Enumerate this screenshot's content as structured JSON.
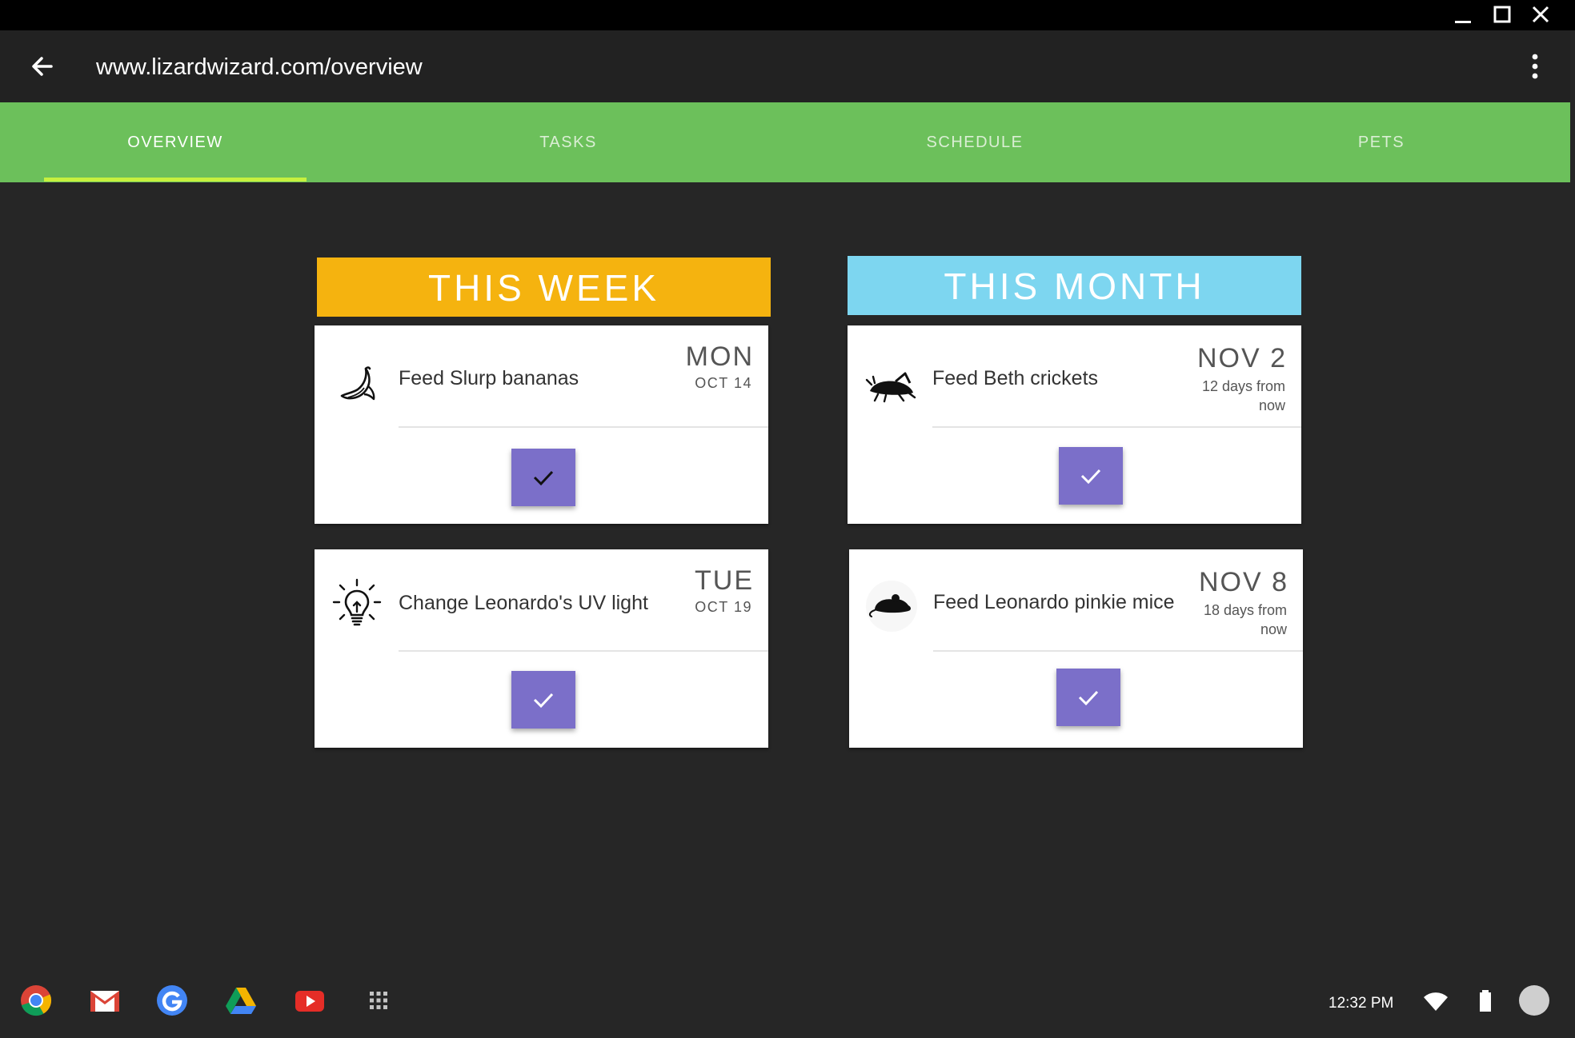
{
  "window": {
    "controls": [
      "minimize-icon",
      "maximize-icon",
      "close-icon"
    ]
  },
  "address_bar": {
    "url": "www.lizardwizard.com/overview",
    "back_icon": "arrow-left-icon",
    "menu_icon": "more-vert-icon"
  },
  "tabs": [
    {
      "label": "OVERVIEW",
      "active": true
    },
    {
      "label": "TASKS",
      "active": false
    },
    {
      "label": "SCHEDULE",
      "active": false
    },
    {
      "label": "PETS",
      "active": false
    }
  ],
  "colors": {
    "tab_bar": "#6cc05b",
    "tab_indicator": "#c6f03f",
    "week_header": "#f5b30f",
    "month_header": "#7dd6f0",
    "check_button": "#7b6fc9",
    "background": "#262626"
  },
  "this_week": {
    "title": "THIS WEEK",
    "items": [
      {
        "icon": "banana-icon",
        "task": "Feed Slurp bananas",
        "day": "MON",
        "date": "OCT 14",
        "check": "dark"
      },
      {
        "icon": "lightbulb-icon",
        "task": "Change Leonardo's UV light",
        "day": "TUE",
        "date": "OCT 19",
        "check": "light"
      }
    ]
  },
  "this_month": {
    "title": "THIS MONTH",
    "items": [
      {
        "icon": "cricket-icon",
        "task": "Feed Beth crickets",
        "day": "NOV 2",
        "relative": "12 days from now"
      },
      {
        "icon": "mouse-icon",
        "task": "Feed Leonardo pinkie mice",
        "day": "NOV 8",
        "relative": "18 days from now"
      }
    ]
  },
  "shelf": {
    "apps": [
      "chrome-icon",
      "gmail-icon",
      "google-icon",
      "drive-icon",
      "youtube-icon",
      "app-launcher-icon"
    ],
    "time": "12:32 PM",
    "tray": [
      "wifi-icon",
      "battery-icon",
      "account-avatar"
    ]
  }
}
